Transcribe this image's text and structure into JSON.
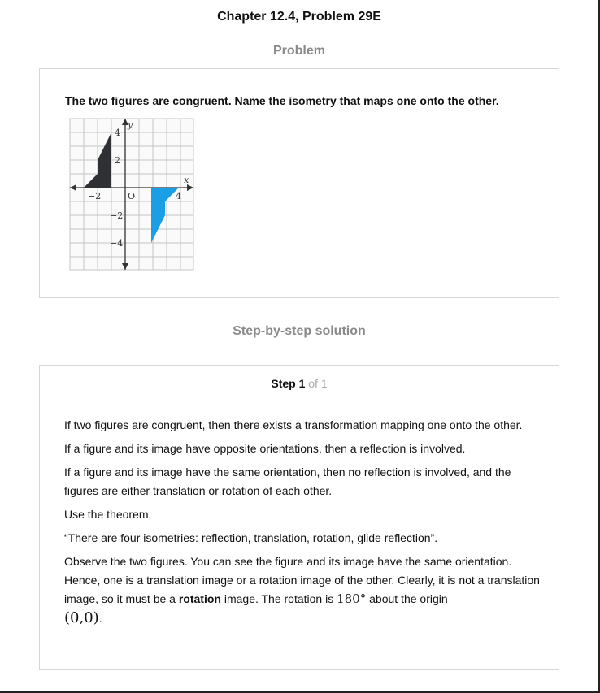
{
  "header": {
    "title": "Chapter 12.4, Problem 29E"
  },
  "problem": {
    "heading": "Problem",
    "text": "The two figures are congruent. Name the isometry that maps one onto the other.",
    "graph": {
      "x_axis_label": "x",
      "y_axis_label": "y",
      "origin_label": "O",
      "tick_x_neg2": "−2",
      "tick_x_4": "4",
      "tick_y_4": "4",
      "tick_y_2": "2",
      "tick_y_neg2": "−2",
      "tick_y_neg4": "−4",
      "original_color": "#2f3033",
      "image_color": "#1a9fe6"
    }
  },
  "solution": {
    "heading": "Step-by-step solution",
    "step_label": "Step 1",
    "step_of": "of 1",
    "paragraphs": {
      "p1": "If two figures are congruent, then there exists a transformation mapping one onto the other.",
      "p2": "If a figure and its image have opposite orientations, then a reflection is involved.",
      "p3": "If a figure and its image have the same orientation, then no reflection is involved, and the figures are either translation or rotation of each other.",
      "p4": "Use the theorem,",
      "p5": "“There are four isometries: reflection, translation, rotation, glide reflection”.",
      "p6_start": "Observe the two figures. You can see the figure and its image have the same orientation. Hence, one is a translation image or a rotation image of the other. Clearly, it is not a translation image, so it must be a ",
      "p6_bold": "rotation",
      "p6_mid": " image. The rotation is ",
      "p6_angle": "180°",
      "p6_about": " about the origin",
      "p6_point": "(0,0)",
      "p6_end": "."
    }
  }
}
